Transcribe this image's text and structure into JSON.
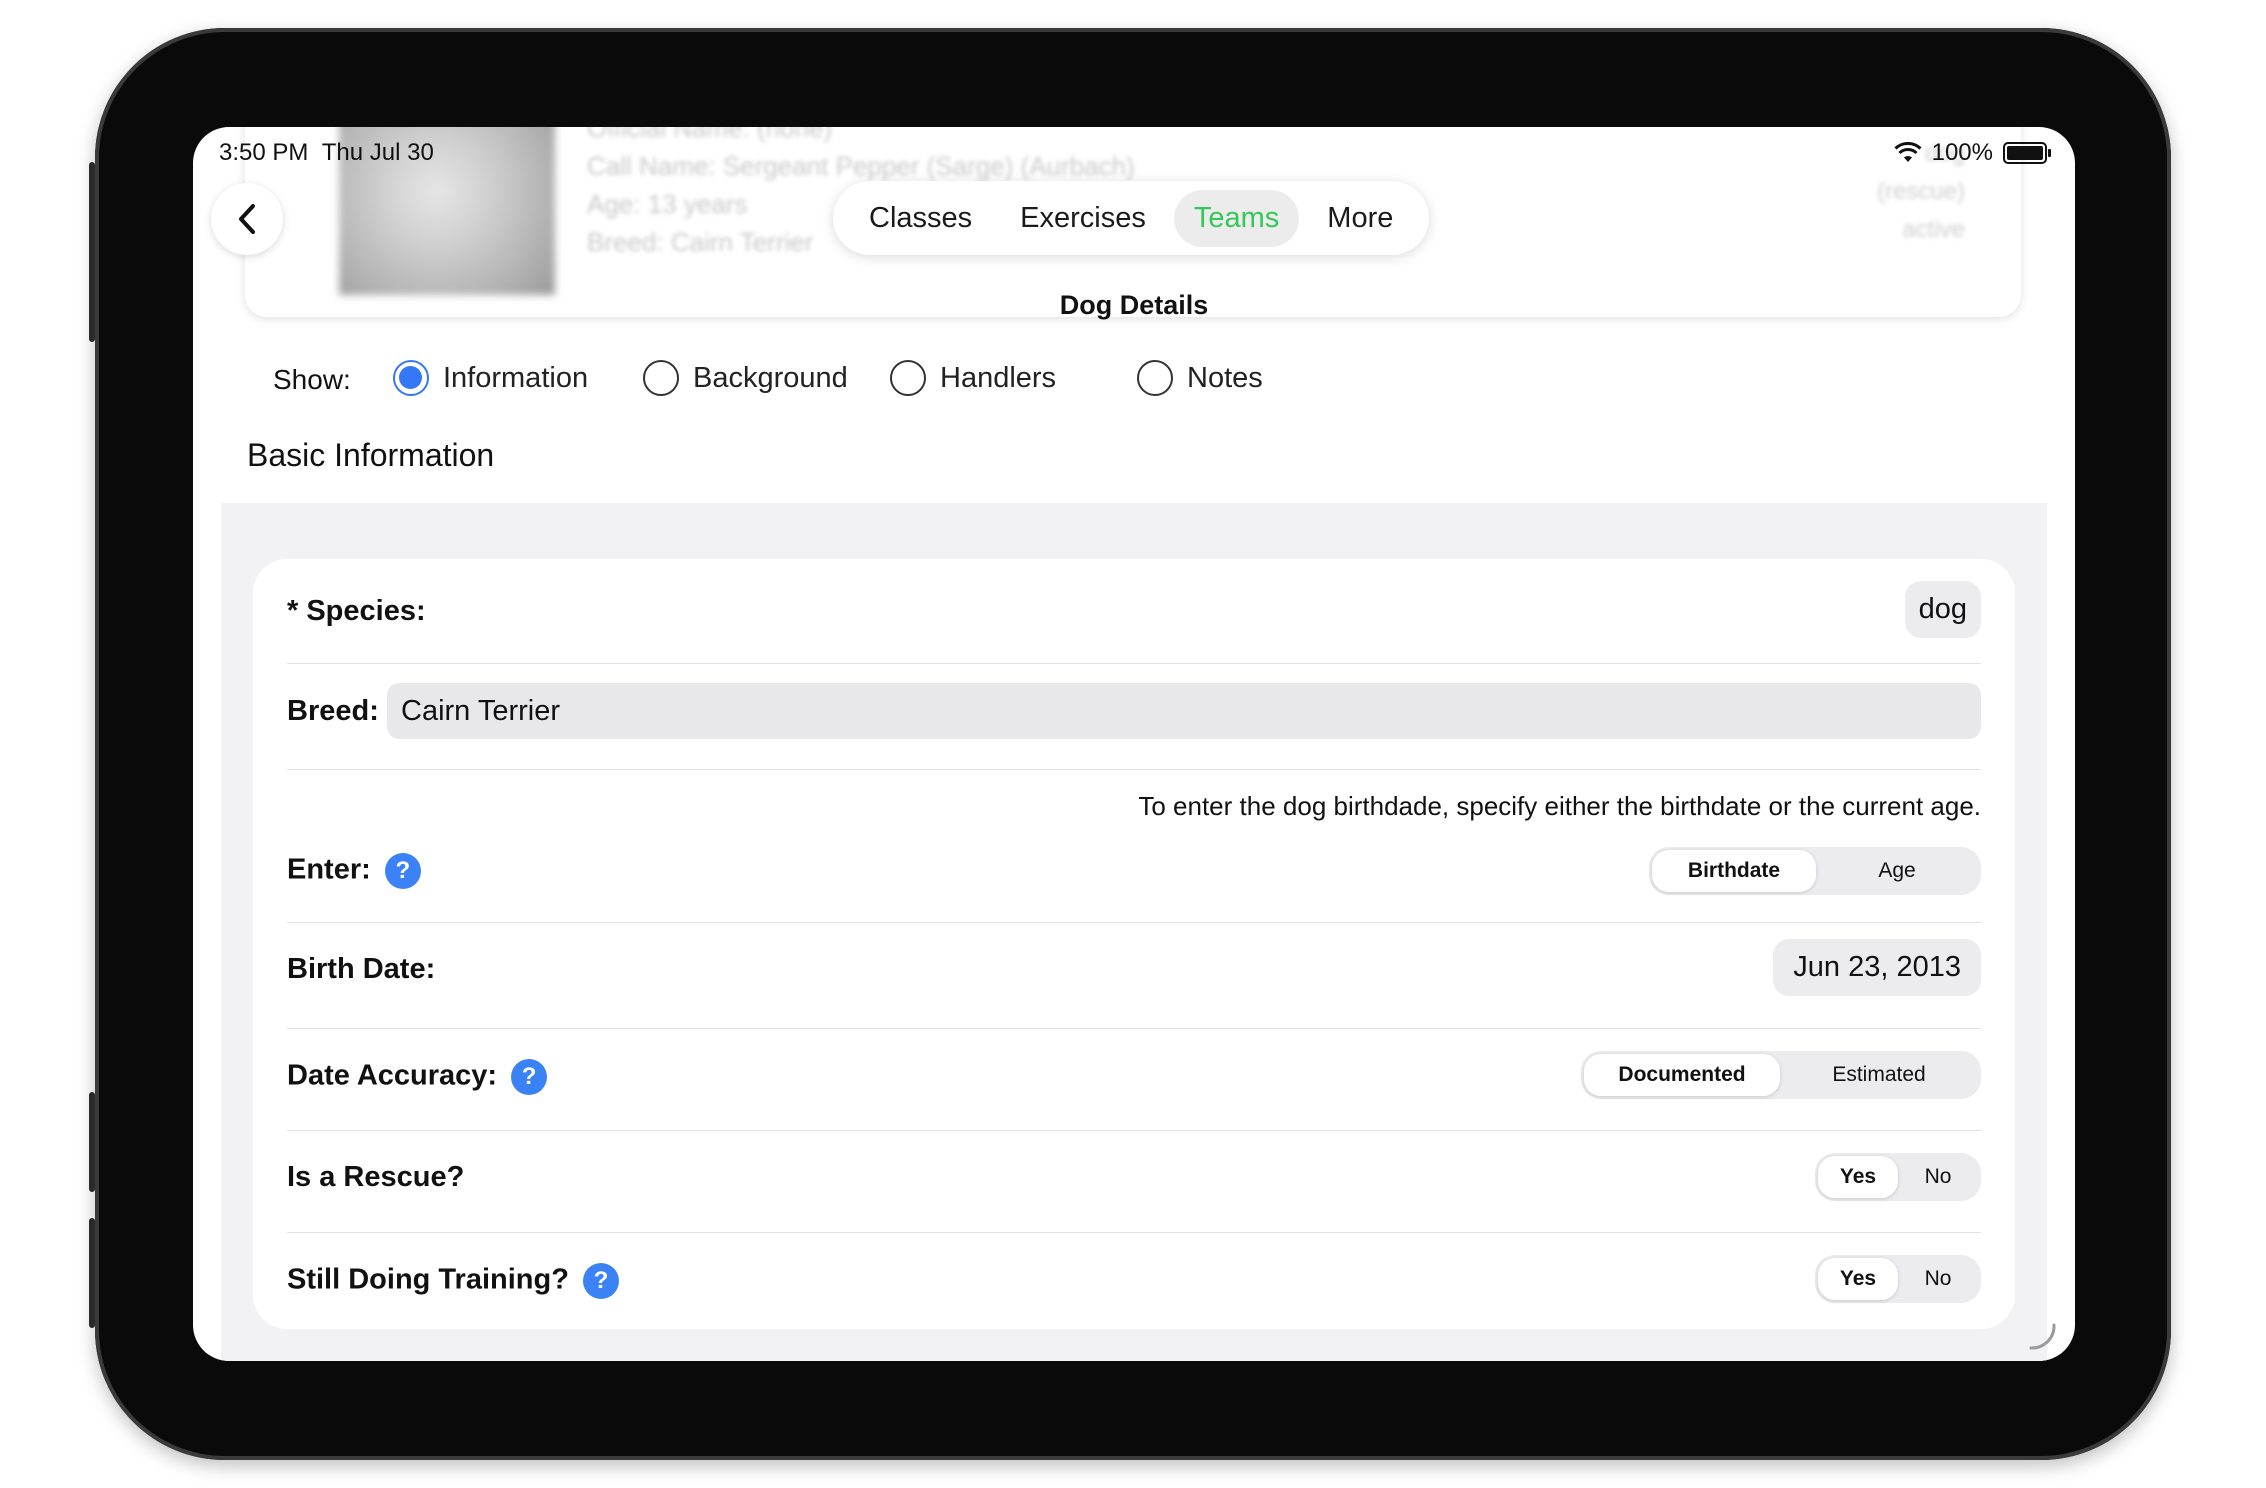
{
  "status_bar": {
    "time": "3:50 PM",
    "date": "Thu Jul 30",
    "battery": "100%"
  },
  "header": {
    "blurred_lines": [
      "Official Name: (none)",
      "Call Name: Sergeant Pepper (Sarge) (Aurbach)",
      "Age: 13 years",
      "Breed: Cairn Terrier"
    ],
    "blurred_right": [
      "dog",
      "(rescue)",
      "active"
    ]
  },
  "nav": {
    "tabs": [
      "Classes",
      "Exercises",
      "Teams",
      "More"
    ],
    "active_tab": "Teams",
    "active_color": "#34c759"
  },
  "page_title": "Dog Details",
  "show": {
    "label": "Show:",
    "options": [
      "Information",
      "Background",
      "Handlers",
      "Notes"
    ],
    "selected": "Information",
    "accent": "#3478f6"
  },
  "section_title": "Basic Information",
  "form": {
    "species": {
      "label": "* Species:",
      "value": "dog"
    },
    "breed": {
      "label": "Breed:",
      "value": "Cairn Terrier"
    },
    "enter": {
      "hint": "To enter the dog birthdade, specify either the birthdate or the current age.",
      "label": "Enter:",
      "help": "?",
      "options": [
        "Birthdate",
        "Age"
      ],
      "selected": "Birthdate"
    },
    "birth_date": {
      "label": "Birth Date:",
      "value": "Jun 23, 2013"
    },
    "date_accuracy": {
      "label": "Date Accuracy:",
      "help": "?",
      "options": [
        "Documented",
        "Estimated"
      ],
      "selected": "Documented"
    },
    "is_rescue": {
      "label": "Is a Rescue?",
      "options": [
        "Yes",
        "No"
      ],
      "selected": "Yes"
    },
    "still_training": {
      "label": "Still Doing Training?",
      "help": "?",
      "options": [
        "Yes",
        "No"
      ],
      "selected": "Yes"
    }
  },
  "icons": {
    "back": "chevron-left-icon",
    "wifi": "wifi-icon",
    "battery": "battery-icon",
    "help": "help-icon",
    "spinner": "loading-spinner-icon"
  }
}
